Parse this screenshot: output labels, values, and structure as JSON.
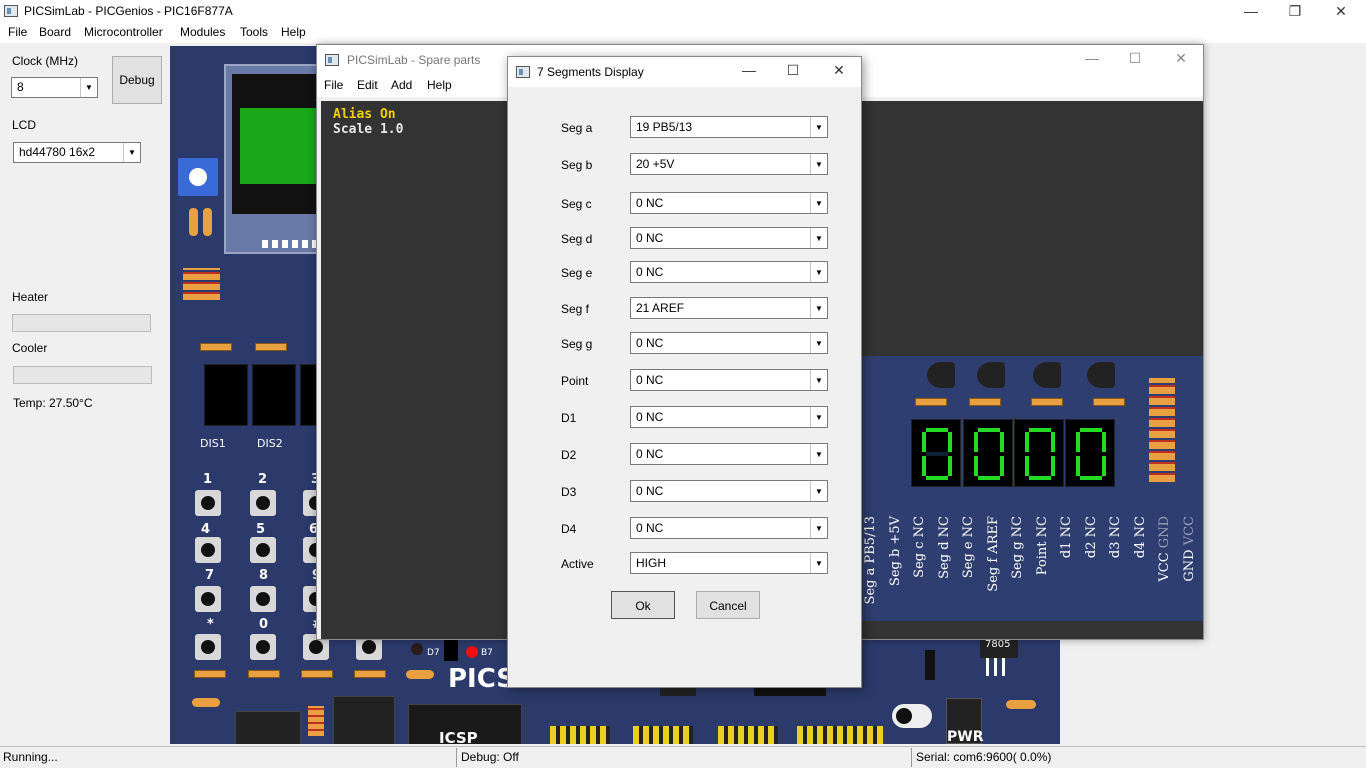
{
  "main_window": {
    "title": "PICSimLab - PICGenios - PIC16F877A",
    "controls": {
      "minimize": "—",
      "restore": "❐",
      "close": "✕"
    },
    "menu": [
      "File",
      "Board",
      "Microcontroller",
      "Modules",
      "Tools",
      "Help"
    ]
  },
  "left_panel": {
    "clock_label": "Clock (MHz)",
    "clock_value": "8",
    "debug_button": "Debug",
    "lcd_label": "LCD",
    "lcd_value": "hd44780 16x2",
    "heater_label": "Heater",
    "cooler_label": "Cooler",
    "temp_text": "Temp: 27.50°C"
  },
  "board": {
    "dis_labels": [
      "DIS1",
      "DIS2"
    ],
    "keys": [
      "1",
      "2",
      "3",
      "4",
      "5",
      "6",
      "7",
      "8",
      "9",
      "*",
      "0",
      "#"
    ],
    "led_labels": [
      "D7",
      "B7"
    ],
    "brand": "PICSimLab",
    "icsp": "ICSP",
    "regulator": "7805",
    "pwr": "PWR"
  },
  "spare_parts": {
    "title": "PICSimLab - Spare parts",
    "menu": [
      "File",
      "Edit",
      "Add",
      "Help"
    ],
    "alias_text": "Alias On",
    "scale_text": "Scale 1.0",
    "pin_labels": [
      {
        "name": "Seg a",
        "conn": "PB5/13"
      },
      {
        "name": "Seg b",
        "conn": "+5V"
      },
      {
        "name": "Seg c",
        "conn": "NC"
      },
      {
        "name": "Seg d",
        "conn": "NC"
      },
      {
        "name": "Seg e",
        "conn": "NC"
      },
      {
        "name": "Seg f",
        "conn": "AREF"
      },
      {
        "name": "Seg g",
        "conn": "NC"
      },
      {
        "name": "Point",
        "conn": "NC"
      },
      {
        "name": "d1",
        "conn": "NC"
      },
      {
        "name": "d2",
        "conn": "NC"
      },
      {
        "name": "d3",
        "conn": "NC"
      },
      {
        "name": "d4",
        "conn": "NC"
      },
      {
        "name": "VCC",
        "conn": "GND"
      },
      {
        "name": "GND",
        "conn": "VCC"
      }
    ]
  },
  "dialog": {
    "title": "7 Segments Display",
    "rows": [
      {
        "label": "Seg a",
        "value": "19  PB5/13"
      },
      {
        "label": "Seg b",
        "value": "20  +5V"
      },
      {
        "label": "Seg c",
        "value": "0  NC"
      },
      {
        "label": "Seg d",
        "value": "0  NC"
      },
      {
        "label": "Seg e",
        "value": "0  NC"
      },
      {
        "label": "Seg f",
        "value": "21  AREF"
      },
      {
        "label": "Seg g",
        "value": "0  NC"
      },
      {
        "label": "Point",
        "value": "0  NC"
      },
      {
        "label": "D1",
        "value": "0  NC"
      },
      {
        "label": "D2",
        "value": "0  NC"
      },
      {
        "label": "D3",
        "value": "0  NC"
      },
      {
        "label": "D4",
        "value": "0  NC"
      },
      {
        "label": "Active",
        "value": "HIGH"
      }
    ],
    "ok": "Ok",
    "cancel": "Cancel"
  },
  "status": {
    "running": "Running...",
    "debug": "Debug: Off",
    "serial": "Serial: com6:9600( 0.0%)"
  },
  "colors": {
    "board_blue": "#2b3a6b",
    "canvas_dark": "#333333",
    "alias_yellow": "#f0d000",
    "lcd_green": "#18a818",
    "segment_green": "#22dd22"
  }
}
